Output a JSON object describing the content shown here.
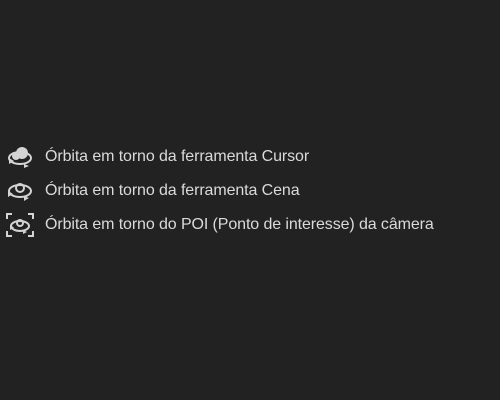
{
  "menu": {
    "items": [
      {
        "label": "Órbita em torno da ferramenta Cursor",
        "icon": "orbit-cursor-icon"
      },
      {
        "label": "Órbita em torno da ferramenta Cena",
        "icon": "orbit-scene-icon"
      },
      {
        "label": "Órbita em torno do POI (Ponto de interesse) da câmera",
        "icon": "orbit-poi-icon"
      }
    ]
  },
  "colors": {
    "background": "#222222",
    "text": "#dadada",
    "icon": "#d4d4d4"
  }
}
